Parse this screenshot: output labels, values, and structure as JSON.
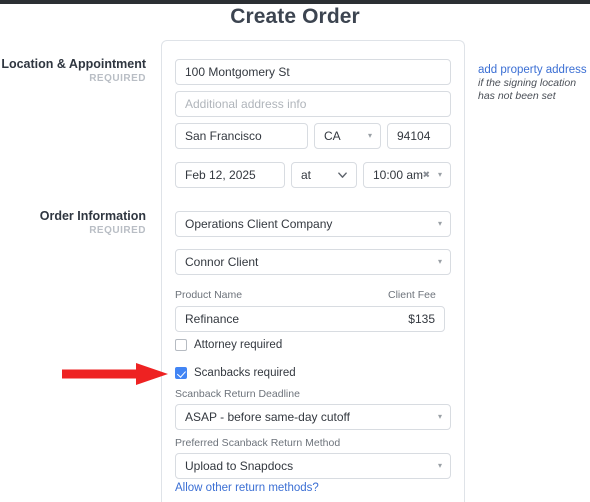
{
  "page": {
    "title": "Create Order"
  },
  "sections": {
    "location": {
      "title": "Location & Appointment",
      "required": "REQUIRED"
    },
    "order": {
      "title": "Order Information",
      "required": "REQUIRED"
    }
  },
  "aside": {
    "link": "add property address",
    "note_line1": "if the signing location",
    "note_line2": "has not been set"
  },
  "location_fields": {
    "street_value": "100 Montgomery St",
    "additional_placeholder": "Additional address info",
    "city_value": "San Francisco",
    "state_value": "CA",
    "zip_value": "94104",
    "date_value": "Feb 12, 2025",
    "at_value": "at",
    "time_value": "10:00 am",
    "clear_icon": "✖",
    "caret_icon": "▾"
  },
  "order_fields": {
    "company_value": "Operations Client Company",
    "contact_value": "Connor Client",
    "product_header": "Product Name",
    "fee_header": "Client Fee",
    "product_value": "Refinance",
    "fee_value": "$135",
    "attorney_label": "Attorney required",
    "attorney_checked": false,
    "scanbacks_label": "Scanbacks required",
    "scanbacks_checked": true,
    "deadline_label": "Scanback Return Deadline",
    "deadline_value": "ASAP - before same-day cutoff",
    "method_label": "Preferred Scanback Return Method",
    "method_value": "Upload to Snapdocs",
    "other_methods_link": "Allow other return methods?"
  },
  "colors": {
    "accent_blue": "#3b6fd4",
    "checkbox_blue": "#4285f4",
    "annotation_red": "#ee2222",
    "topbar": "#2b2f33"
  }
}
